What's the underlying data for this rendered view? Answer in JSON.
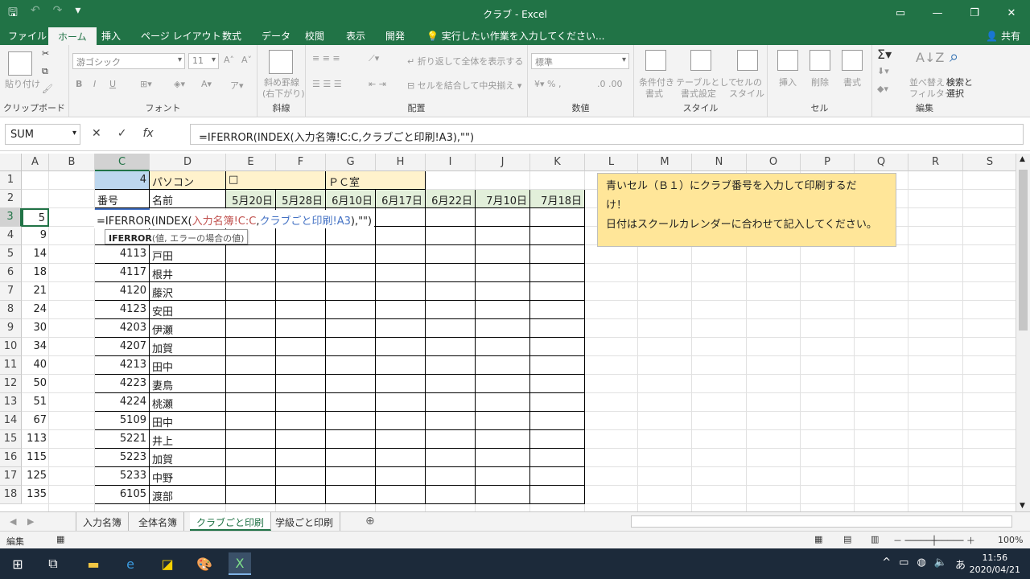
{
  "window": {
    "title": "クラブ - Excel"
  },
  "qat": {
    "save": "🖫",
    "undo": "↶",
    "redo": "↷",
    "more": "▾"
  },
  "tabs": [
    "ファイル",
    "ホーム",
    "挿入",
    "ページ レイアウト",
    "数式",
    "データ",
    "校閲",
    "表示",
    "開発"
  ],
  "tell_me": "実行したい作業を入力してください...",
  "share": "共有",
  "ribbon": {
    "clipboard": {
      "label": "クリップボード",
      "paste": "貼り付け"
    },
    "font": {
      "label": "フォント",
      "name": "游ゴシック",
      "size": "11",
      "bold": "B",
      "italic": "I",
      "underline": "U"
    },
    "slash": {
      "label": "斜線",
      "btn1": "斜め罫線",
      "btn2": "(右下がり)"
    },
    "alignment": {
      "label": "配置",
      "wrap": "折り返して全体を表示する",
      "merge": "セルを結合して中央揃え"
    },
    "number": {
      "label": "数値",
      "format": "標準"
    },
    "styles": {
      "label": "スタイル",
      "cond1": "条件付き",
      "cond2": "書式",
      "table1": "テーブルとして",
      "table2": "書式設定",
      "cell1": "セルの",
      "cell2": "スタイル"
    },
    "cells": {
      "label": "セル",
      "insert": "挿入",
      "delete": "削除",
      "format": "書式"
    },
    "editing": {
      "label": "編集",
      "sort1": "並べ替えと",
      "sort2": "フィルター",
      "find1": "検索と",
      "find2": "選択"
    }
  },
  "formula": {
    "name_box": "SUM",
    "formula": "=IFERROR(INDEX(入力名簿!C:C,クラブごと印刷!A3),\"\")"
  },
  "columns": [
    "A",
    "B",
    "C",
    "D",
    "E",
    "F",
    "G",
    "H",
    "I",
    "J",
    "K",
    "L",
    "M",
    "N",
    "O",
    "P",
    "Q",
    "R",
    "S"
  ],
  "rows": [
    "1",
    "2",
    "3",
    "4",
    "5",
    "6",
    "7",
    "8",
    "9",
    "10",
    "11",
    "12",
    "13",
    "14",
    "15",
    "16",
    "17",
    "18"
  ],
  "row1": {
    "c": "4",
    "d": "パソコン",
    "e": "□",
    "g": "ＰＣ室"
  },
  "row2": {
    "c": "番号",
    "d": "名前",
    "dates": [
      "5月20日",
      "5月28日",
      "6月10日",
      "6月17日",
      "6月22日",
      "7月10日",
      "7月18日"
    ]
  },
  "row3": {
    "a": "5",
    "edit_part1": "=IFERRO",
    "edit_part2": "R(INDEX(",
    "edit_ref1": "入力名簿!C:C",
    "edit_sep": ",",
    "edit_ref2": "クラブごと印刷!A3",
    "edit_tail": "),\"\")"
  },
  "tooltip": {
    "fn": "IFERROR",
    "args": "(値, エラーの場合の値)"
  },
  "data_rows": [
    {
      "a": "9",
      "c": "",
      "d": ""
    },
    {
      "a": "14",
      "c": "4113",
      "d": "戸田"
    },
    {
      "a": "18",
      "c": "4117",
      "d": "根井"
    },
    {
      "a": "21",
      "c": "4120",
      "d": "藤沢"
    },
    {
      "a": "24",
      "c": "4123",
      "d": "安田"
    },
    {
      "a": "30",
      "c": "4203",
      "d": "伊瀬"
    },
    {
      "a": "34",
      "c": "4207",
      "d": "加賀"
    },
    {
      "a": "40",
      "c": "4213",
      "d": "田中"
    },
    {
      "a": "50",
      "c": "4223",
      "d": "妻鳥"
    },
    {
      "a": "51",
      "c": "4224",
      "d": "桃瀬"
    },
    {
      "a": "67",
      "c": "5109",
      "d": "田中"
    },
    {
      "a": "113",
      "c": "5221",
      "d": "井上"
    },
    {
      "a": "115",
      "c": "5223",
      "d": "加賀"
    },
    {
      "a": "125",
      "c": "5233",
      "d": "中野"
    },
    {
      "a": "135",
      "c": "6105",
      "d": "渡部"
    }
  ],
  "note": {
    "line1": "青いセル（Ｂ１）にクラブ番号を入力して印刷するだ",
    "line2": "け！",
    "line3": "日付はスクールカレンダーに合わせて記入してください。"
  },
  "sheets": [
    "入力名簿",
    "全体名簿",
    "クラブごと印刷",
    "学級ごと印刷"
  ],
  "active_sheet": "クラブごと印刷",
  "status": {
    "mode": "編集",
    "zoom": "100%"
  },
  "taskbar": {
    "time": "11:56",
    "date": "2020/04/21",
    "ime": "あ"
  }
}
